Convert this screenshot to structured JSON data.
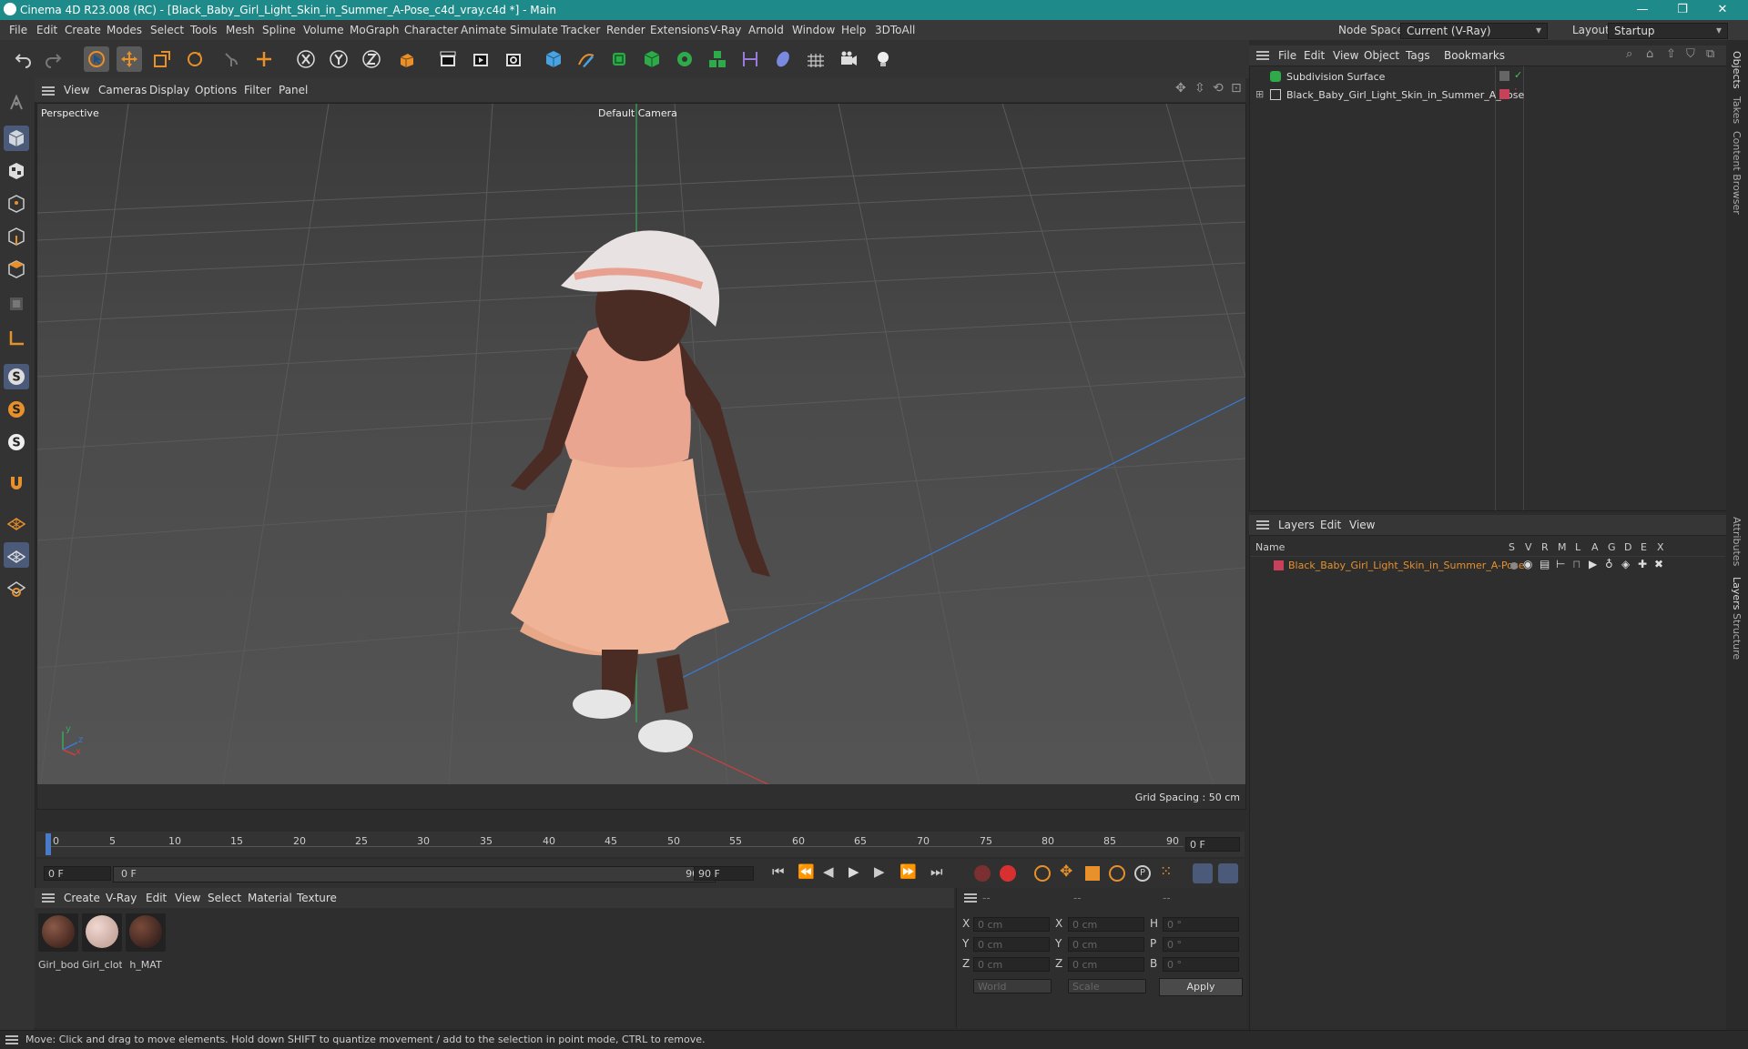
{
  "window": {
    "title": "Cinema 4D R23.008 (RC) - [Black_Baby_Girl_Light_Skin_in_Summer_A-Pose_c4d_vray.c4d *] - Main",
    "minimize": "—",
    "restore": "❐",
    "close": "✕"
  },
  "menubar": {
    "items": [
      "File",
      "Edit",
      "Create",
      "Modes",
      "Select",
      "Tools",
      "Mesh",
      "Spline",
      "Volume",
      "MoGraph",
      "Character",
      "Animate",
      "Simulate",
      "Tracker",
      "Render",
      "Extensions",
      "V-Ray",
      "Arnold",
      "Window",
      "Help",
      "3DToAll"
    ],
    "node_space_label": "Node Space:",
    "node_space_value": "Current (V-Ray)",
    "layout_label": "Layout:",
    "layout_value": "Startup"
  },
  "viewport": {
    "menu": [
      "View",
      "Cameras",
      "Display",
      "Options",
      "Filter",
      "Panel"
    ],
    "name": "Perspective",
    "camera": "Default Camera",
    "grid_spacing": "Grid Spacing : 50 cm",
    "axis_y": "y",
    "axis_z": "z",
    "axis_x": "x"
  },
  "timeline": {
    "ticks": [
      "0",
      "5",
      "10",
      "15",
      "20",
      "25",
      "30",
      "35",
      "40",
      "45",
      "50",
      "55",
      "60",
      "65",
      "70",
      "75",
      "80",
      "85",
      "90"
    ],
    "current_frame_right": "0 F",
    "start_frame": "0 F",
    "range_start": "0 F",
    "range_end": "90 F",
    "end_frame": "90 F"
  },
  "material_manager": {
    "menu": [
      "Create",
      "V-Ray",
      "Edit",
      "View",
      "Select",
      "Material",
      "Texture"
    ],
    "materials": [
      {
        "label": "Girl_bod",
        "color": "#4a2a22"
      },
      {
        "label": "Girl_clotl",
        "color": "#c9a9a0"
      },
      {
        "label": "h_MAT",
        "color": "#3d2520"
      }
    ]
  },
  "coordinates": {
    "header": [
      "--",
      "--",
      "--"
    ],
    "rows": [
      {
        "a": "X",
        "av": "0 cm",
        "b": "X",
        "bv": "0 cm",
        "c": "H",
        "cv": "0 °"
      },
      {
        "a": "Y",
        "av": "0 cm",
        "b": "Y",
        "bv": "0 cm",
        "c": "P",
        "cv": "0 °"
      },
      {
        "a": "Z",
        "av": "0 cm",
        "b": "Z",
        "bv": "0 cm",
        "c": "B",
        "cv": "0 °"
      }
    ],
    "mode1": "World",
    "mode2": "Scale",
    "apply": "Apply"
  },
  "object_manager": {
    "menu": [
      "File",
      "Edit",
      "View",
      "Object",
      "Tags",
      "Bookmarks"
    ],
    "objects": [
      {
        "name": "Subdivision Surface"
      },
      {
        "name": "Black_Baby_Girl_Light_Skin_in_Summer_A_Pose"
      }
    ]
  },
  "layer_manager": {
    "menu": [
      "Layers",
      "Edit",
      "View"
    ],
    "columns": [
      "Name",
      "S",
      "V",
      "R",
      "M",
      "L",
      "A",
      "G",
      "D",
      "E",
      "X"
    ],
    "layer_name": "Black_Baby_Girl_Light_Skin_in_Summer_A-Pose",
    "layer_color": "#c8405a"
  },
  "side_tabs": [
    "Objects",
    "Takes",
    "Content Browser",
    "Attributes",
    "Layers",
    "Structure"
  ],
  "status": "Move: Click and drag to move elements. Hold down SHIFT to quantize movement / add to the selection in point mode, CTRL to remove."
}
